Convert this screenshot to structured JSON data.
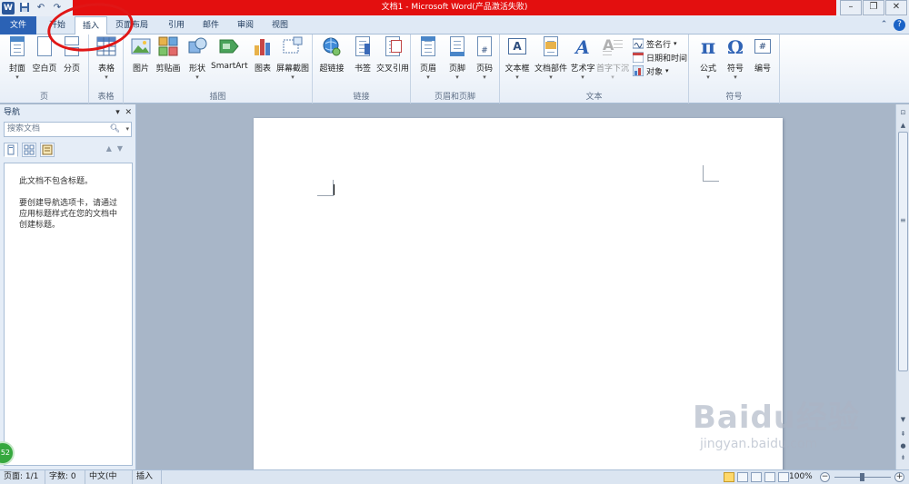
{
  "window": {
    "title": "文档1 - Microsoft Word(产品激活失败)",
    "app_logo": "W",
    "colors": {
      "title_highlight": "#e30f0f",
      "file_tab": "#2b62b5",
      "annotation": "#e01616"
    }
  },
  "quick_access": [
    "save-icon",
    "undo-icon",
    "redo-icon"
  ],
  "tabs": [
    {
      "label": "文件"
    },
    {
      "label": "开始"
    },
    {
      "label": "插入"
    },
    {
      "label": "页面布局"
    },
    {
      "label": "引用"
    },
    {
      "label": "邮件"
    },
    {
      "label": "审阅"
    },
    {
      "label": "视图"
    }
  ],
  "active_tab": "插入",
  "ribbon": {
    "groups": {
      "pages": {
        "label": "页",
        "buttons": [
          "封面",
          "空白页",
          "分页"
        ]
      },
      "tables": {
        "label": "表格",
        "buttons": [
          "表格"
        ]
      },
      "illustrations": {
        "label": "插图",
        "buttons": [
          "图片",
          "剪贴画",
          "形状",
          "SmartArt",
          "图表",
          "屏幕截图"
        ]
      },
      "links": {
        "label": "链接",
        "buttons": [
          "超链接",
          "书签",
          "交叉引用"
        ]
      },
      "header_footer": {
        "label": "页眉和页脚",
        "buttons": [
          "页眉",
          "页脚",
          "页码"
        ]
      },
      "text": {
        "label": "文本",
        "buttons": [
          "文本框",
          "文档部件",
          "艺术字",
          "首字下沉"
        ],
        "small": [
          "签名行",
          "日期和时间",
          "对象"
        ]
      },
      "symbols": {
        "label": "符号",
        "buttons": [
          "公式",
          "符号",
          "编号"
        ]
      }
    }
  },
  "nav_pane": {
    "title": "导航",
    "search_placeholder": "搜索文档",
    "message1": "此文档不包含标题。",
    "message2": "要创建导航选项卡，请通过应用标题样式在您的文档中创建标题。"
  },
  "status": {
    "page": "页面: 1/1",
    "words": "字数: 0",
    "language": "中文(中国)",
    "mode": "插入",
    "zoom": "100%"
  },
  "watermark": {
    "main": "Baidu经验",
    "sub": "jingyan.baidu.com"
  },
  "avatar_badge": "52"
}
